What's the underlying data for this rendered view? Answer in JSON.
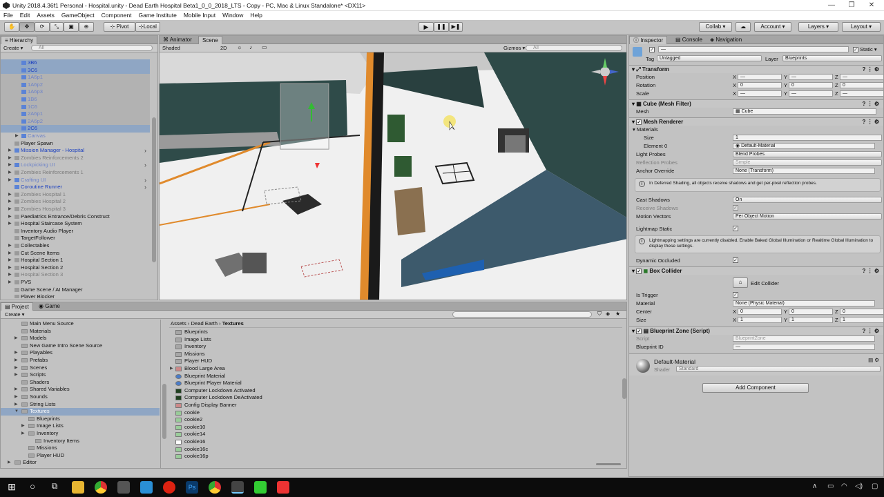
{
  "window": {
    "title": "Unity 2018.4.36f1 Personal - Hospital.unity - Dead Earth Hospital Beta1_0_0_2018_LTS - Copy - PC, Mac & Linux Standalone* <DX11>"
  },
  "menu": [
    "File",
    "Edit",
    "Assets",
    "GameObject",
    "Component",
    "Game Institute",
    "Mobile Input",
    "Window",
    "Help"
  ],
  "toolbar": {
    "pivot": "Pivot",
    "local": "Local",
    "collab": "Collab ▾",
    "account": "Account",
    "layers": "Layers",
    "layout": "Layout"
  },
  "hierarchy": {
    "tab": "Hierarchy",
    "create": "Create ▾",
    "search": "All",
    "items": [
      {
        "label": "3B6",
        "color": "blue",
        "indent": 2,
        "state": "sel"
      },
      {
        "label": "3C6",
        "color": "blue",
        "indent": 2,
        "state": "sel"
      },
      {
        "label": "1A6p1",
        "color": "dimblue",
        "indent": 2,
        "state": "selg"
      },
      {
        "label": "1A6p2",
        "color": "dimblue",
        "indent": 2,
        "state": "selg"
      },
      {
        "label": "1A6p3",
        "color": "dimblue",
        "indent": 2,
        "state": "selg"
      },
      {
        "label": "1B6",
        "color": "dimblue",
        "indent": 2,
        "state": "selg"
      },
      {
        "label": "1C6",
        "color": "dimblue",
        "indent": 2,
        "state": "selg"
      },
      {
        "label": "2A6p1",
        "color": "dimblue",
        "indent": 2,
        "state": "selg"
      },
      {
        "label": "2A6p2",
        "color": "dimblue",
        "indent": 2,
        "state": "selg"
      },
      {
        "label": "2C6",
        "color": "blue",
        "indent": 2,
        "state": "sel"
      },
      {
        "label": "Canvas",
        "color": "dimblue",
        "indent": 2,
        "state": "",
        "arrow": true
      },
      {
        "label": "Player Spawn",
        "color": "",
        "indent": 1,
        "state": ""
      },
      {
        "label": "Mission Manager - Hospital",
        "color": "blue",
        "indent": 1,
        "state": "",
        "arrow": true,
        "more": true
      },
      {
        "label": "Zombies Reinforcements 2",
        "color": "dim",
        "indent": 1,
        "state": "",
        "arrow": true
      },
      {
        "label": "Lockpicking UI",
        "color": "dimblue",
        "indent": 1,
        "state": "",
        "arrow": true,
        "more": true
      },
      {
        "label": "Zombies Reinforcements 1",
        "color": "dim",
        "indent": 1,
        "state": "",
        "arrow": true
      },
      {
        "label": "Crafting UI",
        "color": "dimblue",
        "indent": 1,
        "state": "",
        "arrow": true,
        "more": true
      },
      {
        "label": "Coroutine Runner",
        "color": "blue",
        "indent": 1,
        "state": "",
        "more": true
      },
      {
        "label": "Zombies Hospital 1",
        "color": "dim",
        "indent": 1,
        "state": "",
        "arrow": true
      },
      {
        "label": "Zombies Hospital 2",
        "color": "dim",
        "indent": 1,
        "state": "",
        "arrow": true
      },
      {
        "label": "Zombies Hospital 3",
        "color": "dim",
        "indent": 1,
        "state": "",
        "arrow": true
      },
      {
        "label": "Paediatrics Entrance/Debris Construct",
        "color": "",
        "indent": 1,
        "state": "",
        "arrow": true
      },
      {
        "label": "Hospital Staircase System",
        "color": "",
        "indent": 1,
        "state": "",
        "arrow": true
      },
      {
        "label": "Inventory Audio Player",
        "color": "",
        "indent": 1,
        "state": ""
      },
      {
        "label": "TargetFollower",
        "color": "",
        "indent": 1,
        "state": ""
      },
      {
        "label": "Collectables",
        "color": "",
        "indent": 1,
        "state": "",
        "arrow": true
      },
      {
        "label": "Cut Scene Items",
        "color": "",
        "indent": 1,
        "state": "",
        "arrow": true
      },
      {
        "label": "Hospital Section 1",
        "color": "",
        "indent": 1,
        "state": "",
        "arrow": true
      },
      {
        "label": "Hospital Section 2",
        "color": "",
        "indent": 1,
        "state": "",
        "arrow": true
      },
      {
        "label": "Hospital Section 3",
        "color": "dim",
        "indent": 1,
        "state": "",
        "arrow": true
      },
      {
        "label": "PVS",
        "color": "",
        "indent": 1,
        "state": "",
        "arrow": true
      },
      {
        "label": "Game Scene / AI Manager",
        "color": "",
        "indent": 1,
        "state": ""
      },
      {
        "label": "Player Blocker",
        "color": "",
        "indent": 1,
        "state": ""
      },
      {
        "label": "Player Blocker (1)",
        "color": "",
        "indent": 1,
        "state": ""
      }
    ]
  },
  "scene": {
    "tabs": [
      "Animator",
      "Scene"
    ],
    "shading": "Shaded",
    "mode2d": "2D",
    "gizmos": "Gizmos ▾",
    "search": "All"
  },
  "inspector": {
    "tabs": [
      "Inspector",
      "Console",
      "Navigation"
    ],
    "static": "Static ▾",
    "tag_label": "Tag",
    "tag": "Untagged",
    "layer_label": "Layer",
    "layer": "Blueprints",
    "transform": {
      "title": "Transform",
      "position": "Position",
      "rotation": "Rotation",
      "scale": "Scale",
      "pos": [
        "—",
        "—",
        "—"
      ],
      "rot": [
        "0",
        "0",
        "0"
      ],
      "scl": [
        "—",
        "—",
        "—"
      ]
    },
    "meshfilter": {
      "title": "Cube (Mesh Filter)",
      "mesh_label": "Mesh",
      "mesh": "Cube"
    },
    "meshrenderer": {
      "title": "Mesh Renderer",
      "materials": "Materials",
      "size_label": "Size",
      "size": "1",
      "element_label": "Element 0",
      "element": "Default-Material",
      "light_probes_label": "Light Probes",
      "light_probes": "Blend Probes",
      "reflection_label": "Reflection Probes",
      "reflection": "Simple",
      "anchor_label": "Anchor Override",
      "anchor": "None (Transform)",
      "help1": "In Deferred Shading, all objects receive shadows and get per-pixel reflection probes.",
      "cast_label": "Cast Shadows",
      "cast": "On",
      "receive_label": "Receive Shadows",
      "motion_label": "Motion Vectors",
      "motion": "Per Object Motion",
      "lightmap_label": "Lightmap Static",
      "help2": "Lightmapping settings are currently disabled. Enable Baked Global Illumination or Realtime Global Illumination to display these settings.",
      "occluded_label": "Dynamic Occluded"
    },
    "boxcollider": {
      "title": "Box Collider",
      "edit": "Edit Collider",
      "trigger_label": "Is Trigger",
      "material_label": "Material",
      "material": "None (Physic Material)",
      "center_label": "Center",
      "center": [
        "0",
        "0",
        "0"
      ],
      "size_label": "Size",
      "size": [
        "1",
        "1",
        "1"
      ]
    },
    "blueprint": {
      "title": "Blueprint Zone (Script)",
      "script_label": "Script",
      "script": "BlueprintZone",
      "id_label": "Blueprint ID",
      "id": "—"
    },
    "material": {
      "title": "Default-Material",
      "shader_label": "Shader",
      "shader": "Standard"
    },
    "add_component": "Add Component"
  },
  "project": {
    "tabs": [
      "Project",
      "Game"
    ],
    "create": "Create ▾",
    "tree": [
      {
        "label": "Main Menu Source",
        "indent": 2
      },
      {
        "label": "Materials",
        "indent": 2
      },
      {
        "label": "Models",
        "indent": 2,
        "arrow": true
      },
      {
        "label": "New Game Intro Scene Source",
        "indent": 2
      },
      {
        "label": "Playables",
        "indent": 2,
        "arrow": true
      },
      {
        "label": "Prefabs",
        "indent": 2,
        "arrow": true
      },
      {
        "label": "Scenes",
        "indent": 2,
        "arrow": true
      },
      {
        "label": "Scripts",
        "indent": 2,
        "arrow": true
      },
      {
        "label": "Shaders",
        "indent": 2
      },
      {
        "label": "Shared Variables",
        "indent": 2,
        "arrow": true
      },
      {
        "label": "Sounds",
        "indent": 2,
        "arrow": true
      },
      {
        "label": "String Lists",
        "indent": 2,
        "arrow": true
      },
      {
        "label": "Textures",
        "indent": 2,
        "arrow": true,
        "sel": true
      },
      {
        "label": "Blueprints",
        "indent": 3
      },
      {
        "label": "Image Lists",
        "indent": 3,
        "arrow": true
      },
      {
        "label": "Inventory",
        "indent": 3,
        "arrow": true
      },
      {
        "label": "Inventory Items",
        "indent": 4
      },
      {
        "label": "Missions",
        "indent": 3
      },
      {
        "label": "Player HUD",
        "indent": 3
      },
      {
        "label": "Editor",
        "indent": 1,
        "arrow": true
      }
    ],
    "breadcrumb": [
      "Assets",
      "Dead Earth",
      "Textures"
    ],
    "files": [
      {
        "label": "Blueprints",
        "type": "folder"
      },
      {
        "label": "Image Lists",
        "type": "folder"
      },
      {
        "label": "Inventory",
        "type": "folder"
      },
      {
        "label": "Missions",
        "type": "folder"
      },
      {
        "label": "Player HUD",
        "type": "folder"
      },
      {
        "label": "Blood Large Area",
        "type": "tex",
        "arrow": true
      },
      {
        "label": "Blueprint Material",
        "type": "mat"
      },
      {
        "label": "Blueprint Player Material",
        "type": "mat"
      },
      {
        "label": "Computer Lockdown Activated",
        "type": "dark"
      },
      {
        "label": "Computer Lockdown DeActivated",
        "type": "dark"
      },
      {
        "label": "Config Display Banner",
        "type": "tex"
      },
      {
        "label": "cookie",
        "type": "ck"
      },
      {
        "label": "cookie2",
        "type": "ck"
      },
      {
        "label": "cookie10",
        "type": "ck"
      },
      {
        "label": "cookie14",
        "type": "ck"
      },
      {
        "label": "cookie16",
        "type": "white"
      },
      {
        "label": "cookie16c",
        "type": "ck"
      },
      {
        "label": "cookie16p",
        "type": "ck"
      }
    ]
  },
  "colors": {
    "accent": "#8fa6c4",
    "orange": "#e08a2c",
    "wall": "#2e4a48"
  }
}
